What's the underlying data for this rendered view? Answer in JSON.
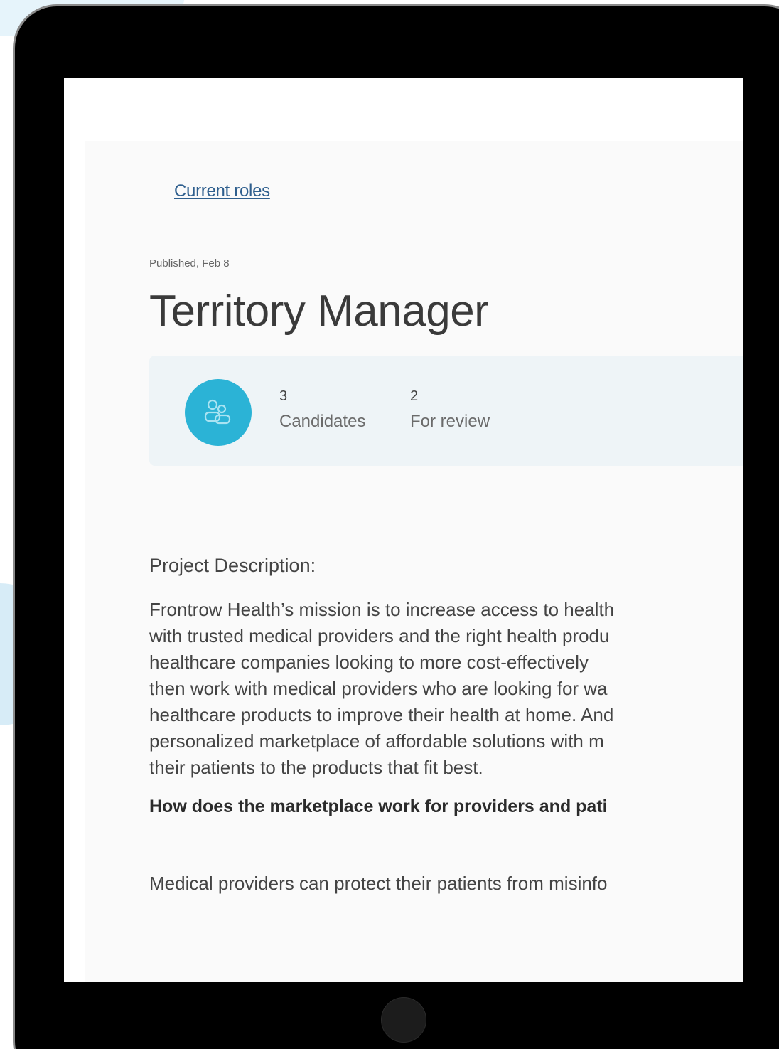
{
  "breadcrumb": {
    "current_roles_link": "Current roles"
  },
  "job": {
    "published": "Published, Feb 8",
    "title": "Territory Manager"
  },
  "stats": {
    "candidates": {
      "count": "3",
      "label": "Candidates"
    },
    "for_review": {
      "count": "2",
      "label": "For review"
    }
  },
  "description": {
    "heading": "Project Description:",
    "paragraph_lines": [
      "Frontrow Health’s mission is to increase access to health",
      "with trusted medical providers and the right health produ",
      "healthcare companies looking to more cost-effectively",
      "then work with medical providers who are looking for wa",
      "healthcare products to improve their health at home. And",
      "personalized marketplace of affordable solutions with m",
      "their patients to the products that fit best."
    ],
    "subheading": "How does the marketplace work for providers and pati",
    "paragraph_2": "Medical providers can protect their patients from misinfo"
  },
  "icons": {
    "avatar": "users-icon",
    "home_button": "home-button"
  },
  "colors": {
    "accent": "#2bb3d6",
    "link": "#2f5f8e",
    "card_bg": "#eef4f7"
  }
}
